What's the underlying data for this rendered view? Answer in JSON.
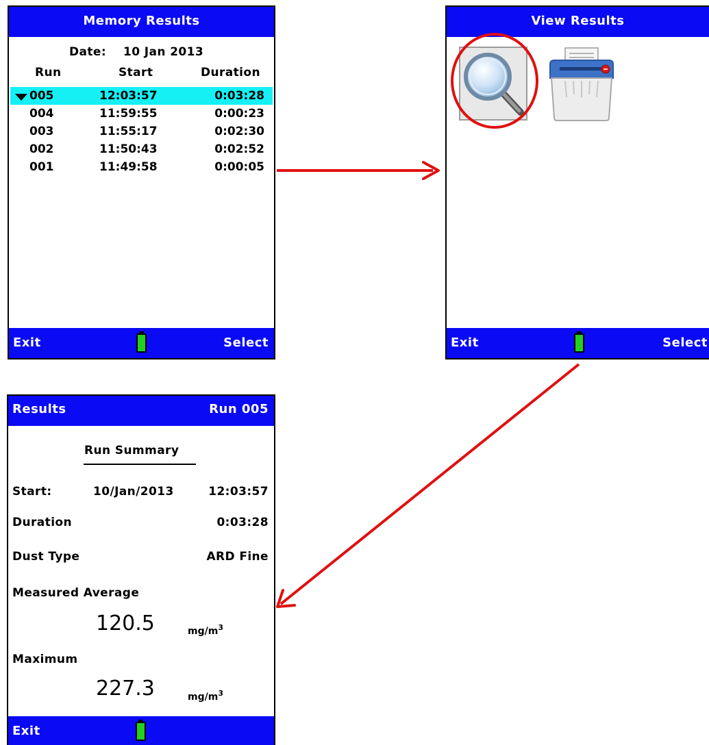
{
  "memory_results": {
    "title": "Memory Results",
    "date_label": "Date:",
    "date_value": "10 Jan 2013",
    "columns": [
      "Run",
      "Start",
      "Duration"
    ],
    "rows": [
      {
        "run": "005",
        "start": "12:03:57",
        "duration": "0:03:28"
      },
      {
        "run": "004",
        "start": "11:59:55",
        "duration": "0:00:23"
      },
      {
        "run": "003",
        "start": "11:55:17",
        "duration": "0:02:30"
      },
      {
        "run": "002",
        "start": "11:50:43",
        "duration": "0:02:52"
      },
      {
        "run": "001",
        "start": "11:49:58",
        "duration": "0:00:05"
      }
    ],
    "selected_row": "005",
    "exit_label": "Exit",
    "select_label": "Select"
  },
  "view_results": {
    "title": "View Results",
    "icons": [
      "magnifier-icon",
      "shredder-icon"
    ],
    "exit_label": "Exit",
    "select_label": "Select"
  },
  "results": {
    "title": "Results",
    "run_label": "Run 005",
    "summary_heading": "Run Summary",
    "start_label": "Start:",
    "start_date": "10/Jan/2013",
    "start_time": "12:03:57",
    "duration_label": "Duration",
    "duration_value": "0:03:28",
    "dust_type_label": "Dust Type",
    "dust_type_value": "ARD Fine",
    "measured_average_label": "Measured Average",
    "measured_average_value": "120.5",
    "maximum_label": "Maximum",
    "maximum_value": "227.3",
    "unit": "mg/m",
    "unit_exponent": "3",
    "exit_label": "Exit"
  },
  "colors": {
    "bar_blue": "#0a0af5",
    "highlight_cyan": "#15f0f5",
    "arrow_red": "#e01010",
    "battery_green": "#22d022"
  }
}
